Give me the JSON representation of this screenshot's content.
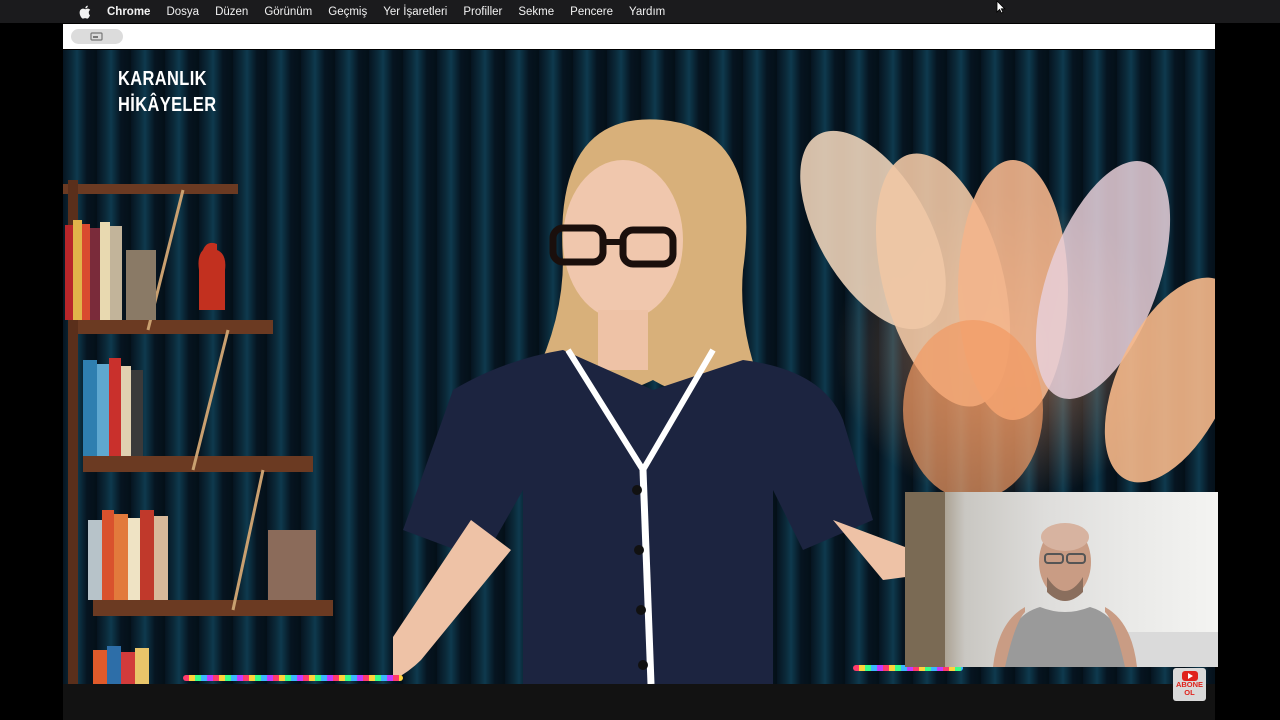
{
  "menubar": {
    "apple_icon": "apple-logo-icon",
    "app_name": "Chrome",
    "items": [
      "Dosya",
      "Düzen",
      "Görünüm",
      "Geçmiş",
      "Yer İşaretleri",
      "Profiller",
      "Sekme",
      "Pencere",
      "Yardım"
    ]
  },
  "browser": {
    "tab_icon": "window-icon"
  },
  "video": {
    "channel_logo": [
      "KARANLIK",
      "HİKÂYELER"
    ]
  },
  "subscribe": {
    "line1": "ABONE",
    "line2": "OL"
  },
  "colors": {
    "menubar_bg": "#1b1b1d",
    "subscribe_red": "#e0231c",
    "shirt_navy": "#1c2440"
  }
}
